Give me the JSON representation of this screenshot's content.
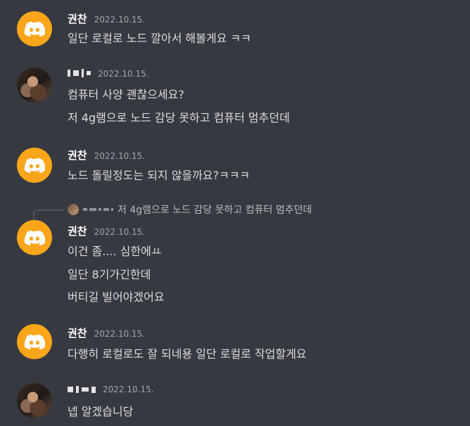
{
  "messages": [
    {
      "user": "권찬",
      "time": "2022.10.15.",
      "lines": [
        "일단 로컬로 노드 깔아서 해볼게요 ㅋㅋ"
      ]
    },
    {
      "user": "",
      "time": "2022.10.15.",
      "lines": [
        "컴퓨터 사양 괜찮으세요?",
        "저 4g램으로 노드 감당 못하고 컴퓨터 멈추던데"
      ]
    },
    {
      "user": "권찬",
      "time": "2022.10.15.",
      "lines": [
        "노드 돌릴정도는 되지 않을까요?ㅋㅋㅋ"
      ]
    },
    {
      "user": "권찬",
      "time": "2022.10.15.",
      "reply": "저 4g램으로 노드 감당 못하고 컴퓨터 멈추던데",
      "lines": [
        "이건 좀.... 심한에ㅛ",
        "일단 8기가긴한데",
        "버티길 빌어야겠어요"
      ]
    },
    {
      "user": "권찬",
      "time": "2022.10.15.",
      "lines": [
        "다행히 로컬로도 잘 되네용 일단 로컬로 작업할게요"
      ]
    },
    {
      "user": "",
      "time": "2022.10.15.",
      "lines": [
        "넵 알겠습니당"
      ]
    }
  ],
  "colors": {
    "background": "#36393f",
    "discord_avatar": "#faa61a",
    "text": "#dcddde"
  },
  "icons": {
    "discord_avatar": "discord-logo-icon"
  }
}
